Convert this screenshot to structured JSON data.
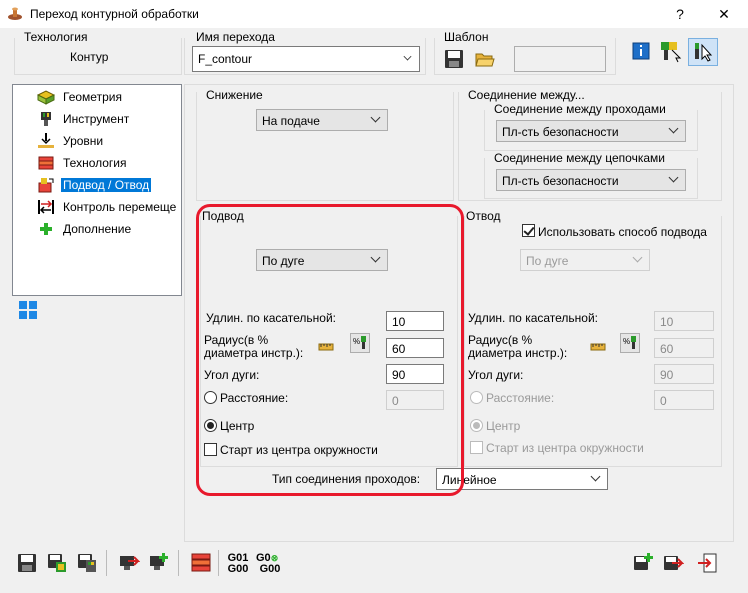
{
  "window": {
    "title": "Переход контурной обработки",
    "help": "?",
    "close": "✕"
  },
  "header": {
    "tech_label": "Технология",
    "tech_value": "Контур",
    "name_label": "Имя перехода",
    "name_value": "F_contour",
    "template_label": "Шаблон",
    "template_value": ""
  },
  "tree": {
    "items": [
      {
        "label": "Геометрия",
        "icon": "geometry-icon"
      },
      {
        "label": "Инструмент",
        "icon": "tool-icon"
      },
      {
        "label": "Уровни",
        "icon": "levels-icon"
      },
      {
        "label": "Технология",
        "icon": "technology-icon"
      },
      {
        "label": "Подвод / Отвод",
        "icon": "approach-icon",
        "selected": true
      },
      {
        "label": "Контроль перемеще",
        "icon": "motion-control-icon"
      },
      {
        "label": "Дополнение",
        "icon": "add-icon"
      }
    ]
  },
  "lowering": {
    "label": "Снижение",
    "value": "На подаче"
  },
  "connection": {
    "label": "Соединение между...",
    "passes_label": "Соединение между проходами",
    "passes_value": "Пл-сть безопасности",
    "chains_label": "Соединение между цепочками",
    "chains_value": "Пл-сть безопасности"
  },
  "approach": {
    "label": "Подвод",
    "type": "По дуге",
    "tangent_label": "Удлин. по касательной:",
    "tangent_value": "10",
    "radius_label_1": "Радиус(в %",
    "radius_label_2": "диаметра инстр.):",
    "radius_value": "60",
    "arc_label": "Угол дуги:",
    "arc_value": "90",
    "distance_label": "Расстояние:",
    "distance_value": "0",
    "center_label": "Центр",
    "start_center_label": "Старт из центра окружности"
  },
  "retract": {
    "label": "Отвод",
    "use_approach_label": "Использовать способ подвода",
    "type": "По дуге",
    "tangent_label": "Удлин. по касательной:",
    "tangent_value": "10",
    "radius_label_1": "Радиус(в %",
    "radius_label_2": "диаметра инстр.):",
    "radius_value": "60",
    "arc_label": "Угол дуги:",
    "arc_value": "90",
    "distance_label": "Расстояние:",
    "distance_value": "0",
    "center_label": "Центр",
    "start_center_label": "Старт из центра окружности"
  },
  "pass_connection": {
    "label": "Тип соединения проходов:",
    "value": "Линейное"
  },
  "toolbar": {
    "g01": "G01",
    "g00a": "G00",
    "g0": "G0",
    "g00b": "G00"
  },
  "colors": {
    "highlight": "#e8192c",
    "selection": "#0078d7"
  }
}
